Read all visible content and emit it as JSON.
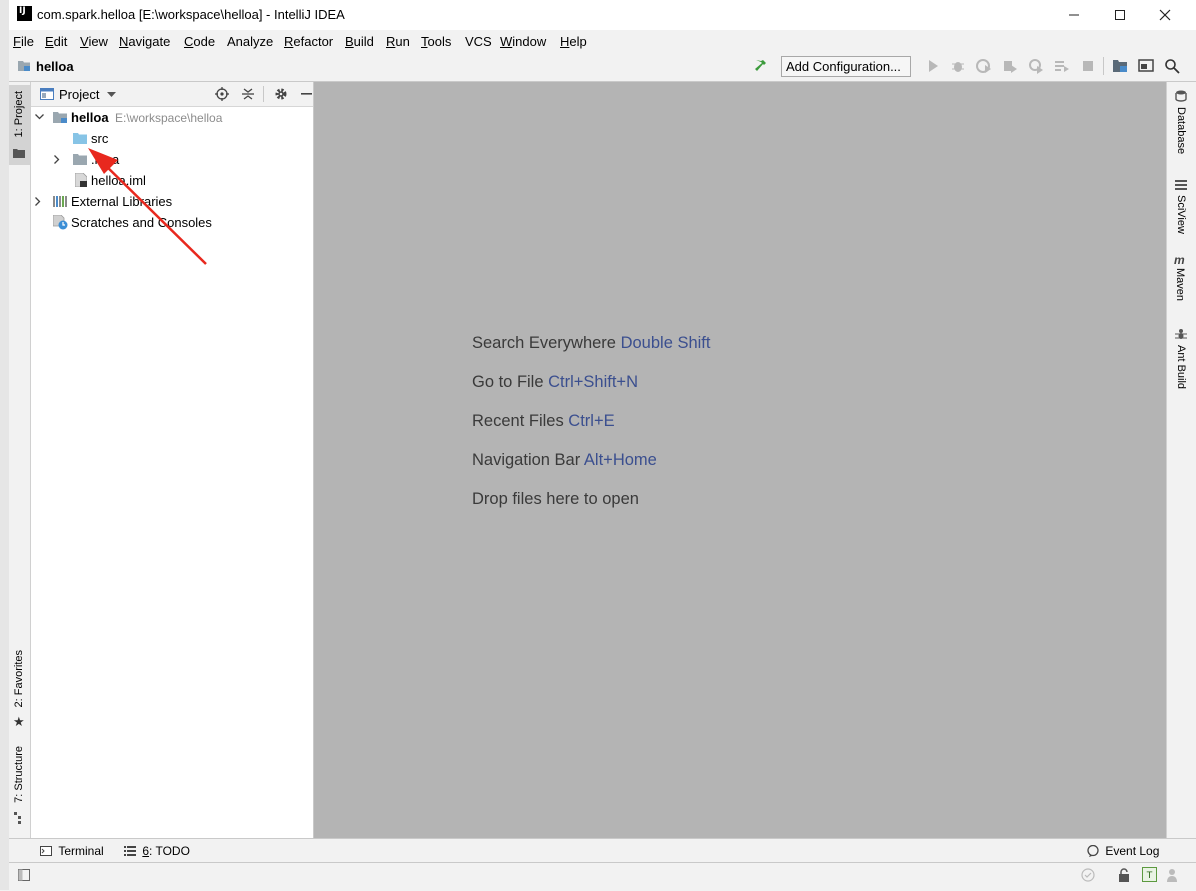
{
  "window": {
    "title": "com.spark.helloa [E:\\workspace\\helloa] - IntelliJ IDEA",
    "app_icon_text": "IJ"
  },
  "menu": [
    {
      "label": "File",
      "mnemonic": "F",
      "rest": "ile"
    },
    {
      "label": "Edit",
      "mnemonic": "E",
      "rest": "dit"
    },
    {
      "label": "View",
      "mnemonic": "V",
      "rest": "iew"
    },
    {
      "label": "Navigate",
      "mnemonic": "N",
      "rest": "avigate"
    },
    {
      "label": "Code",
      "mnemonic": "C",
      "rest": "ode"
    },
    {
      "label": "Analyze",
      "mnemonic": "",
      "rest": "Analyze"
    },
    {
      "label": "Refactor",
      "mnemonic": "R",
      "rest": "efactor"
    },
    {
      "label": "Build",
      "mnemonic": "B",
      "rest": "uild"
    },
    {
      "label": "Run",
      "mnemonic": "R",
      "rest": "un"
    },
    {
      "label": "Tools",
      "mnemonic": "T",
      "rest": "ools"
    },
    {
      "label": "VCS",
      "mnemonic": "",
      "rest": "VCS"
    },
    {
      "label": "Window",
      "mnemonic": "W",
      "rest": "indow"
    },
    {
      "label": "Help",
      "mnemonic": "H",
      "rest": "elp"
    }
  ],
  "navbar": {
    "project": "helloa",
    "add_configuration": "Add Configuration..."
  },
  "left_stripe": {
    "project": "1: Project",
    "favorites": "2: Favorites",
    "structure": "7: Structure"
  },
  "project_panel": {
    "title": "Project",
    "tree": [
      {
        "label": "helloa",
        "path": "E:\\workspace\\helloa",
        "icon": "module-folder-icon",
        "expanded": true
      },
      {
        "label": "src",
        "icon": "source-folder-icon"
      },
      {
        "label": ".idea",
        "icon": "folder-icon",
        "expanded": false
      },
      {
        "label": "helloa.iml",
        "icon": "iml-file-icon"
      },
      {
        "label": "External Libraries",
        "icon": "libraries-icon",
        "expanded": false
      },
      {
        "label": "Scratches and Consoles",
        "icon": "scratches-icon"
      }
    ]
  },
  "editor_hints": [
    {
      "text": "Search Everywhere",
      "key": "Double Shift"
    },
    {
      "text": "Go to File",
      "key": "Ctrl+Shift+N"
    },
    {
      "text": "Recent Files",
      "key": "Ctrl+E"
    },
    {
      "text": "Navigation Bar",
      "key": "Alt+Home"
    },
    {
      "text": "Drop files here to open",
      "key": ""
    }
  ],
  "right_stripe": [
    "Database",
    "SciView",
    "Maven",
    "Ant Build"
  ],
  "bottom_tools": {
    "terminal": "Terminal",
    "todo_num": "6",
    "todo": ": TODO",
    "event_log": "Event Log"
  },
  "colors": {
    "editor_bg": "#b4b4b4",
    "hint_key": "#3b4f8f",
    "annotation_arrow": "#e8281e",
    "hammer": "#3c9b3c"
  }
}
